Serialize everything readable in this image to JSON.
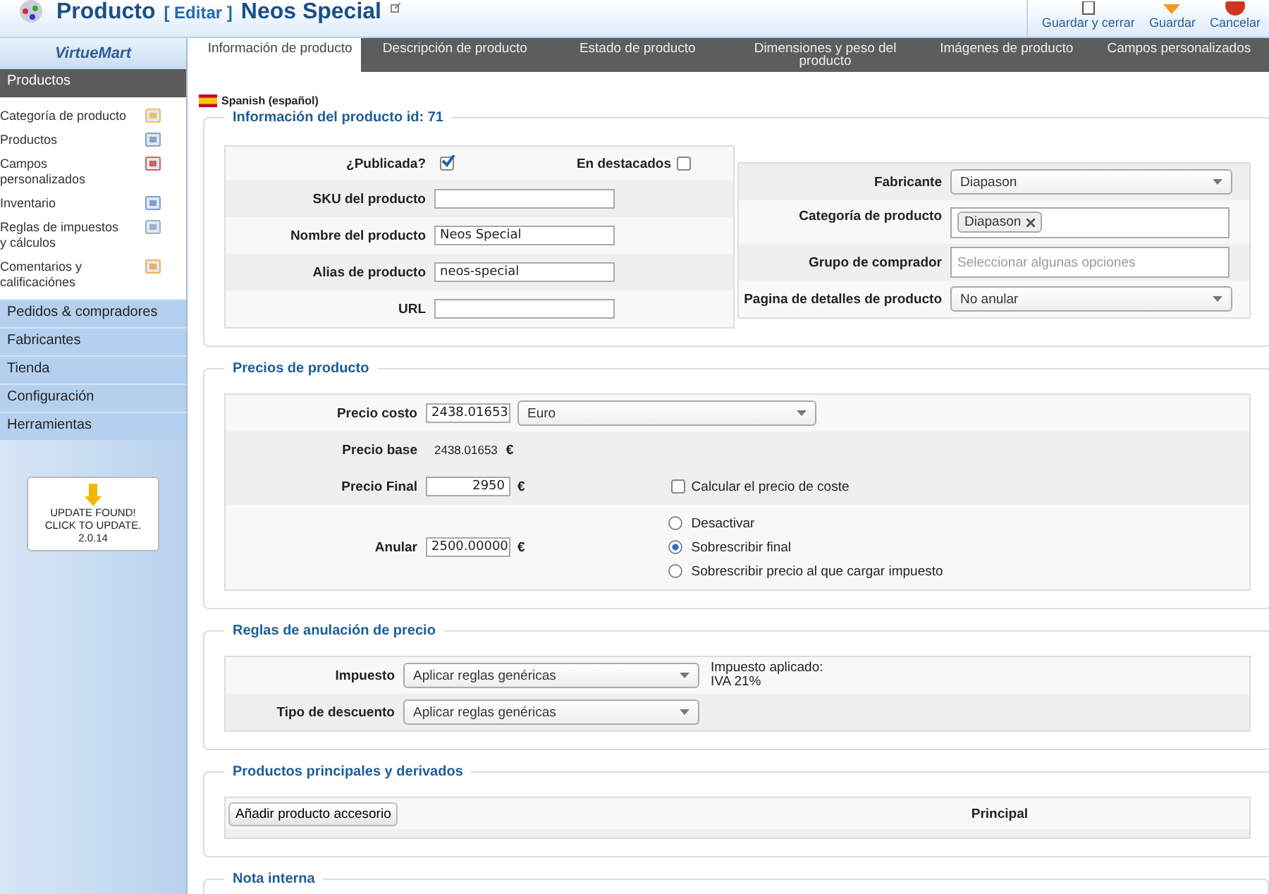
{
  "header": {
    "title": "Producto",
    "edit_label": "[ Editar ]",
    "product_name": "Neos Special",
    "actions": [
      {
        "label": "Guardar y cerrar",
        "kind": "save-close"
      },
      {
        "label": "Guardar",
        "kind": "save"
      },
      {
        "label": "Cancelar",
        "kind": "cancel"
      }
    ]
  },
  "sidebar": {
    "logo": "VirtueMart",
    "sections": [
      {
        "label": "Productos",
        "selected": true,
        "items": [
          {
            "label": "Categoría de producto"
          },
          {
            "label": "Productos"
          },
          {
            "label": "Campos personalizados"
          },
          {
            "label": "Inventario"
          },
          {
            "label": "Reglas de impuestos y cálculos"
          },
          {
            "label": "Comentarios y calificaciónes"
          }
        ]
      },
      {
        "label": "Pedidos & compradores",
        "selected": false
      },
      {
        "label": "Fabricantes",
        "selected": false
      },
      {
        "label": "Tienda",
        "selected": false
      },
      {
        "label": "Configuración",
        "selected": false
      },
      {
        "label": "Herramientas",
        "selected": false
      }
    ],
    "update_notice": [
      "UPDATE FOUND!",
      "CLICK TO UPDATE.",
      "2.0.14"
    ]
  },
  "tabs": [
    {
      "label": "Información de producto",
      "selected": true
    },
    {
      "label": "Descripción de producto",
      "selected": false
    },
    {
      "label": "Estado de producto",
      "selected": false
    },
    {
      "label": "Dimensiones y peso del producto",
      "selected": false
    },
    {
      "label": "Imágenes de producto",
      "selected": false
    },
    {
      "label": "Campos personalizados",
      "selected": false
    }
  ],
  "language": "Spanish (español)",
  "product_info": {
    "legend": "Información del producto id: 71",
    "published": {
      "label": "¿Publicada?",
      "checked": true
    },
    "featured": {
      "label": "En destacados",
      "checked": false
    },
    "fields": [
      {
        "label": "SKU del producto"
      },
      {
        "label": "Nombre del producto",
        "value": "Neos Special"
      },
      {
        "label": "Alias de producto",
        "value": "neos-special"
      },
      {
        "label": "URL"
      }
    ],
    "right_fields": [
      {
        "label": "Fabricante",
        "kind": "select",
        "value": "Diapason"
      },
      {
        "label": "Categoría de producto",
        "kind": "tags",
        "tags": [
          "Diapason"
        ]
      },
      {
        "label": "Grupo de comprador",
        "kind": "multiselect",
        "placeholder": "Seleccionar algunas opciones"
      },
      {
        "label": "Pagina de detalles de producto",
        "kind": "select",
        "value": "No anular"
      }
    ]
  },
  "prices": {
    "legend": "Precios de producto",
    "cost": {
      "label": "Precio costo",
      "value": "2438.01653",
      "currency": "Euro"
    },
    "base": {
      "label": "Precio base",
      "value": "2438.01653",
      "symbol": "€"
    },
    "final": {
      "label": "Precio Final",
      "value": "2950",
      "symbol": "€",
      "calc": {
        "label": "Calcular el precio de coste",
        "checked": false
      }
    },
    "override": {
      "label": "Anular",
      "value": "2500.00000",
      "symbol": "€",
      "options": [
        {
          "label": "Desactivar",
          "selected": false
        },
        {
          "label": "Sobrescribir final",
          "selected": true
        },
        {
          "label": "Sobrescribir precio al que cargar impuesto",
          "selected": false
        }
      ]
    }
  },
  "rules": {
    "legend": "Reglas de anulación de precio",
    "rows": [
      {
        "label": "Impuesto",
        "value": "Aplicar reglas genéricas",
        "note": [
          "Impuesto aplicado:",
          "IVA 21%"
        ]
      },
      {
        "label": "Tipo de descuento",
        "value": "Aplicar reglas genéricas"
      }
    ]
  },
  "related": {
    "legend": "Productos principales y derivados",
    "button": "Añadir producto accesorio",
    "column": "Principal"
  },
  "notes": {
    "legend": "Nota interna"
  }
}
